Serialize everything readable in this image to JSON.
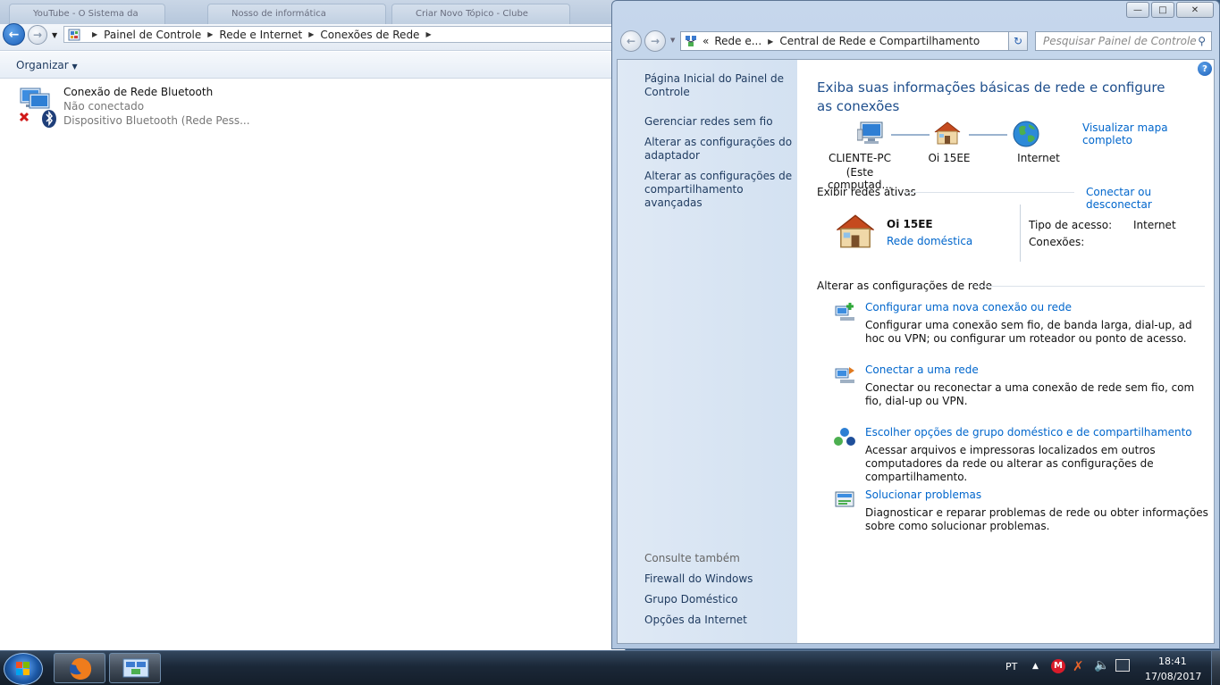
{
  "back_window": {
    "tabs": [
      "YouTube - O Sistema da",
      "Nosso de informática",
      "Criar Novo Tópico - Clube"
    ],
    "breadcrumb": [
      "Painel de Controle",
      "Rede e Internet",
      "Conexões de Rede"
    ],
    "command_bar": {
      "organize": "Organizar"
    },
    "items": [
      {
        "name": "Conexão de Rede Bluetooth",
        "status": "Não conectado",
        "device": "Dispositivo Bluetooth (Rede Pess..."
      }
    ]
  },
  "front_window": {
    "title_buttons": {
      "minimize": "—",
      "maximize": "□",
      "close": "✕"
    },
    "address": {
      "prefix": "«",
      "crumbs": [
        "Rede e...",
        "Central de Rede e Compartilhamento"
      ]
    },
    "search_placeholder": "Pesquisar Painel de Controle",
    "left_pane": {
      "links": [
        "Página Inicial do Painel de Controle",
        "Gerenciar redes sem fio",
        "Alterar as configurações do adaptador",
        "Alterar as configurações de compartilhamento avançadas"
      ],
      "see_also_title": "Consulte também",
      "see_also": [
        "Firewall do Windows",
        "Grupo Doméstico",
        "Opções da Internet"
      ]
    },
    "main": {
      "heading": "Exiba suas informações básicas de rede e configure as conexões",
      "view_map": "Visualizar mapa completo",
      "nodes": [
        {
          "name": "CLIENTE-PC",
          "sub": "(Este computad..."
        },
        {
          "name": "Oi 15EE",
          "sub": ""
        },
        {
          "name": "Internet",
          "sub": ""
        }
      ],
      "active_networks_title": "Exibir redes ativas",
      "connect_disconnect": "Conectar ou desconectar",
      "network": {
        "name": "Oi 15EE",
        "type": "Rede doméstica",
        "access_label": "Tipo de acesso:",
        "access_value": "Internet",
        "connections_label": "Conexões:"
      },
      "change_settings_title": "Alterar as configurações de rede",
      "tasks": [
        {
          "title": "Configurar uma nova conexão ou rede",
          "desc": "Configurar uma conexão sem fio, de banda larga, dial-up, ad hoc ou VPN; ou configurar um roteador ou ponto de acesso."
        },
        {
          "title": "Conectar a uma rede",
          "desc": "Conectar ou reconectar a uma conexão de rede sem fio, com fio, dial-up ou VPN."
        },
        {
          "title": "Escolher opções de grupo doméstico e de compartilhamento",
          "desc": "Acessar arquivos e impressoras localizados em outros computadores da rede ou alterar as configurações de compartilhamento."
        },
        {
          "title": "Solucionar problemas",
          "desc": "Diagnosticar e reparar problemas de rede ou obter informações sobre como solucionar problemas."
        }
      ]
    }
  },
  "taskbar": {
    "language": "PT",
    "time": "18:41",
    "date": "17/08/2017"
  },
  "colors": {
    "link": "#0066cc",
    "heading": "#1e4e8c",
    "left_pane": "#d9e5f3"
  }
}
